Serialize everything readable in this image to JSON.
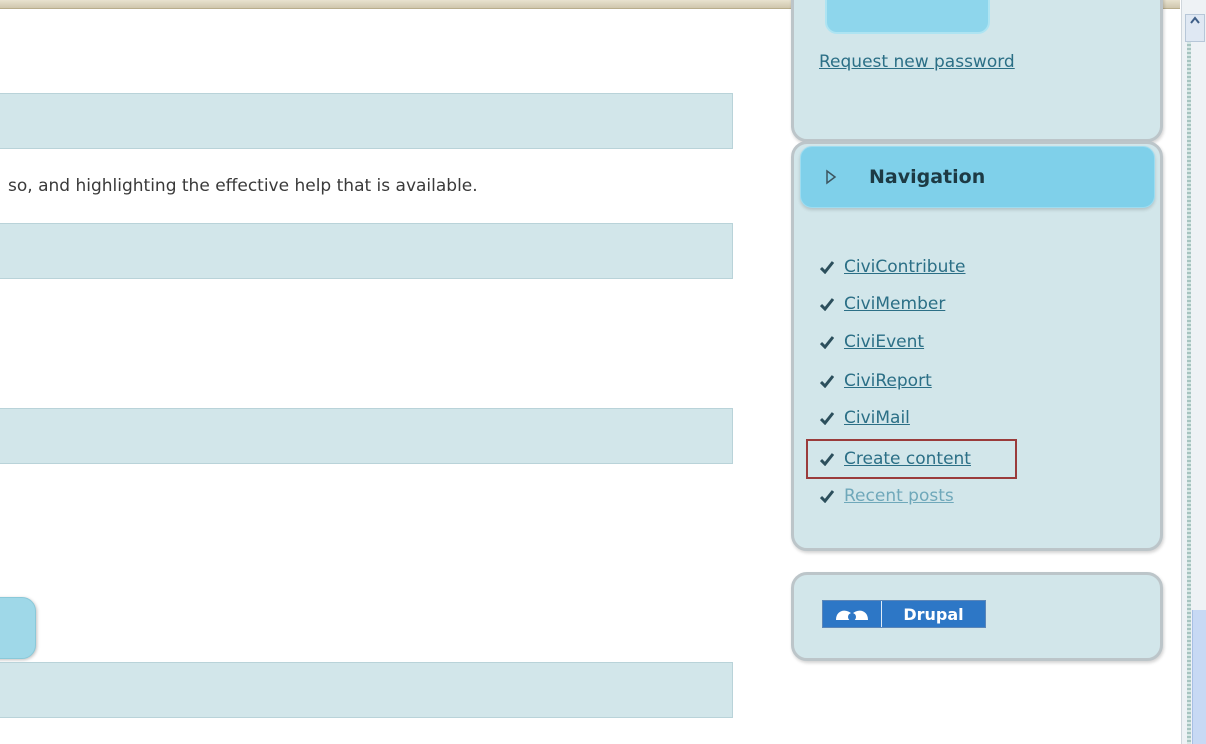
{
  "main": {
    "body_text": "so, and highlighting the effective help that is available."
  },
  "login_block": {
    "request_password_link": "Request new password"
  },
  "navigation": {
    "title": "Navigation",
    "items": [
      {
        "label": "CiviContribute"
      },
      {
        "label": "CiviMember"
      },
      {
        "label": "CiviEvent"
      },
      {
        "label": "CiviReport"
      },
      {
        "label": "CiviMail"
      },
      {
        "label": "Create content"
      },
      {
        "label": "Recent posts"
      }
    ],
    "highlighted_item": "Create content"
  },
  "footer_block": {
    "badge_text": "Drupal"
  },
  "colors": {
    "content_bar": "#d2e6ea",
    "nav_header": "#7fd0ea",
    "link": "#2b6f86",
    "highlight_border": "#9a3b3b"
  },
  "icons": [
    "check-icon",
    "triangle-right-icon",
    "drupal-drop-icon",
    "scroll-up-arrow-icon"
  ]
}
